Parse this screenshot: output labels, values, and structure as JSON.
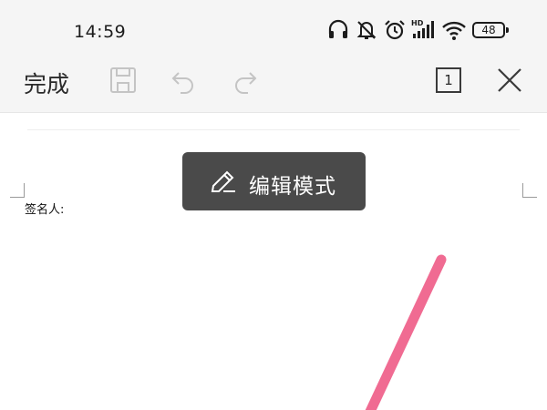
{
  "status_bar": {
    "time": "14:59",
    "battery_level": "48",
    "icons": [
      "headphones-icon",
      "mute-icon",
      "alarm-icon",
      "hd-signal-icon",
      "wifi-icon",
      "battery-icon"
    ]
  },
  "toolbar": {
    "done_label": "完成",
    "page_count": "1",
    "icons": [
      "save-icon",
      "undo-icon",
      "redo-icon",
      "page-count-icon",
      "close-icon"
    ]
  },
  "document": {
    "signer_label": "签名人:",
    "ink_color": "#f06b92"
  },
  "toast": {
    "text": "编辑模式",
    "icon": "pencil-icon"
  },
  "colors": {
    "bar_background": "#f5f5f5",
    "toast_background": "#4a4a4a",
    "ink": "#f06b92"
  }
}
